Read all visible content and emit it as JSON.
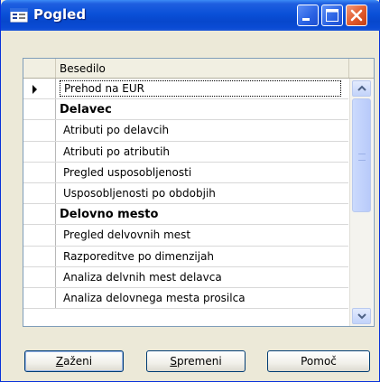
{
  "window": {
    "title": "Pogled",
    "icon": "list-window-icon"
  },
  "titlebar_buttons": {
    "minimize": "minimize-icon",
    "maximize": "maximize-icon",
    "close": "close-icon"
  },
  "grid": {
    "column_header": "Besedilo",
    "rows": [
      {
        "text": "Prehod na EUR",
        "style": "item",
        "current": true
      },
      {
        "text": "Delavec",
        "style": "heading"
      },
      {
        "text": "Atributi po delavcih",
        "style": "item"
      },
      {
        "text": "Atributi po atributih",
        "style": "item"
      },
      {
        "text": "Pregled usposobljenosti",
        "style": "item"
      },
      {
        "text": "Usposobljenosti po obdobjih",
        "style": "item"
      },
      {
        "text": "Delovno mesto",
        "style": "heading"
      },
      {
        "text": "Pregled delvovnih mest",
        "style": "item"
      },
      {
        "text": "Razporeditve po dimenzijah",
        "style": "item"
      },
      {
        "text": "Analiza delvnih mest delavca",
        "style": "item"
      },
      {
        "text": "Analiza delovnega mesta prosilca",
        "style": "item"
      }
    ]
  },
  "buttons": {
    "run": {
      "first": "Z",
      "rest": "aženi"
    },
    "edit": {
      "first": "S",
      "rest": "premeni"
    },
    "help": {
      "label": "Pomoč"
    }
  },
  "colors": {
    "titlebar": "#0a50d8",
    "face": "#ece9d8",
    "close": "#e15a2c"
  }
}
